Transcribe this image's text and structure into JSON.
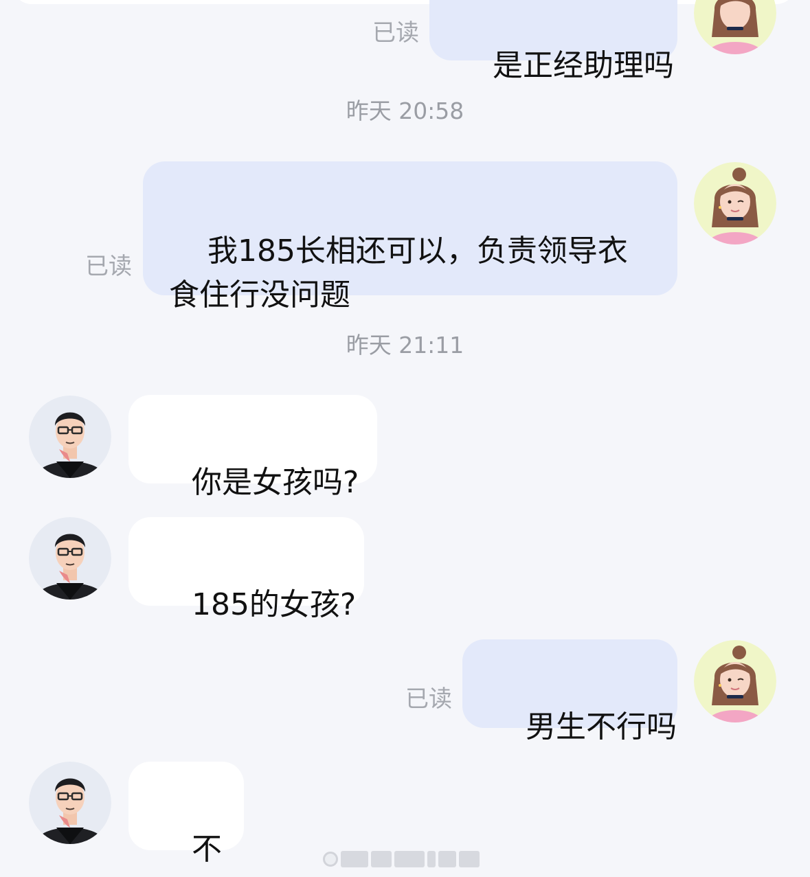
{
  "colors": {
    "background": "#f5f6fa",
    "outgoing_bubble": "#e3e9fa",
    "incoming_bubble": "#ffffff",
    "timestamp_text": "#9a9da4",
    "read_text": "#a5a8af"
  },
  "messages": {
    "m0": {
      "text": "是正经助理吗",
      "status": "已读"
    },
    "t1": {
      "text": "昨天 20:58"
    },
    "m1": {
      "text": "我185长相还可以，负责领导衣食住行没问题",
      "status": "已读"
    },
    "t2": {
      "text": "昨天 21:11"
    },
    "m2": {
      "text": "你是女孩吗?"
    },
    "m3": {
      "text": "185的女孩?"
    },
    "m4": {
      "text": "男生不行吗",
      "status": "已读"
    },
    "m5": {
      "text": "不行"
    }
  },
  "avatars": {
    "self": "girl-avatar-icon",
    "contact": "man-with-glasses-avatar-icon"
  }
}
